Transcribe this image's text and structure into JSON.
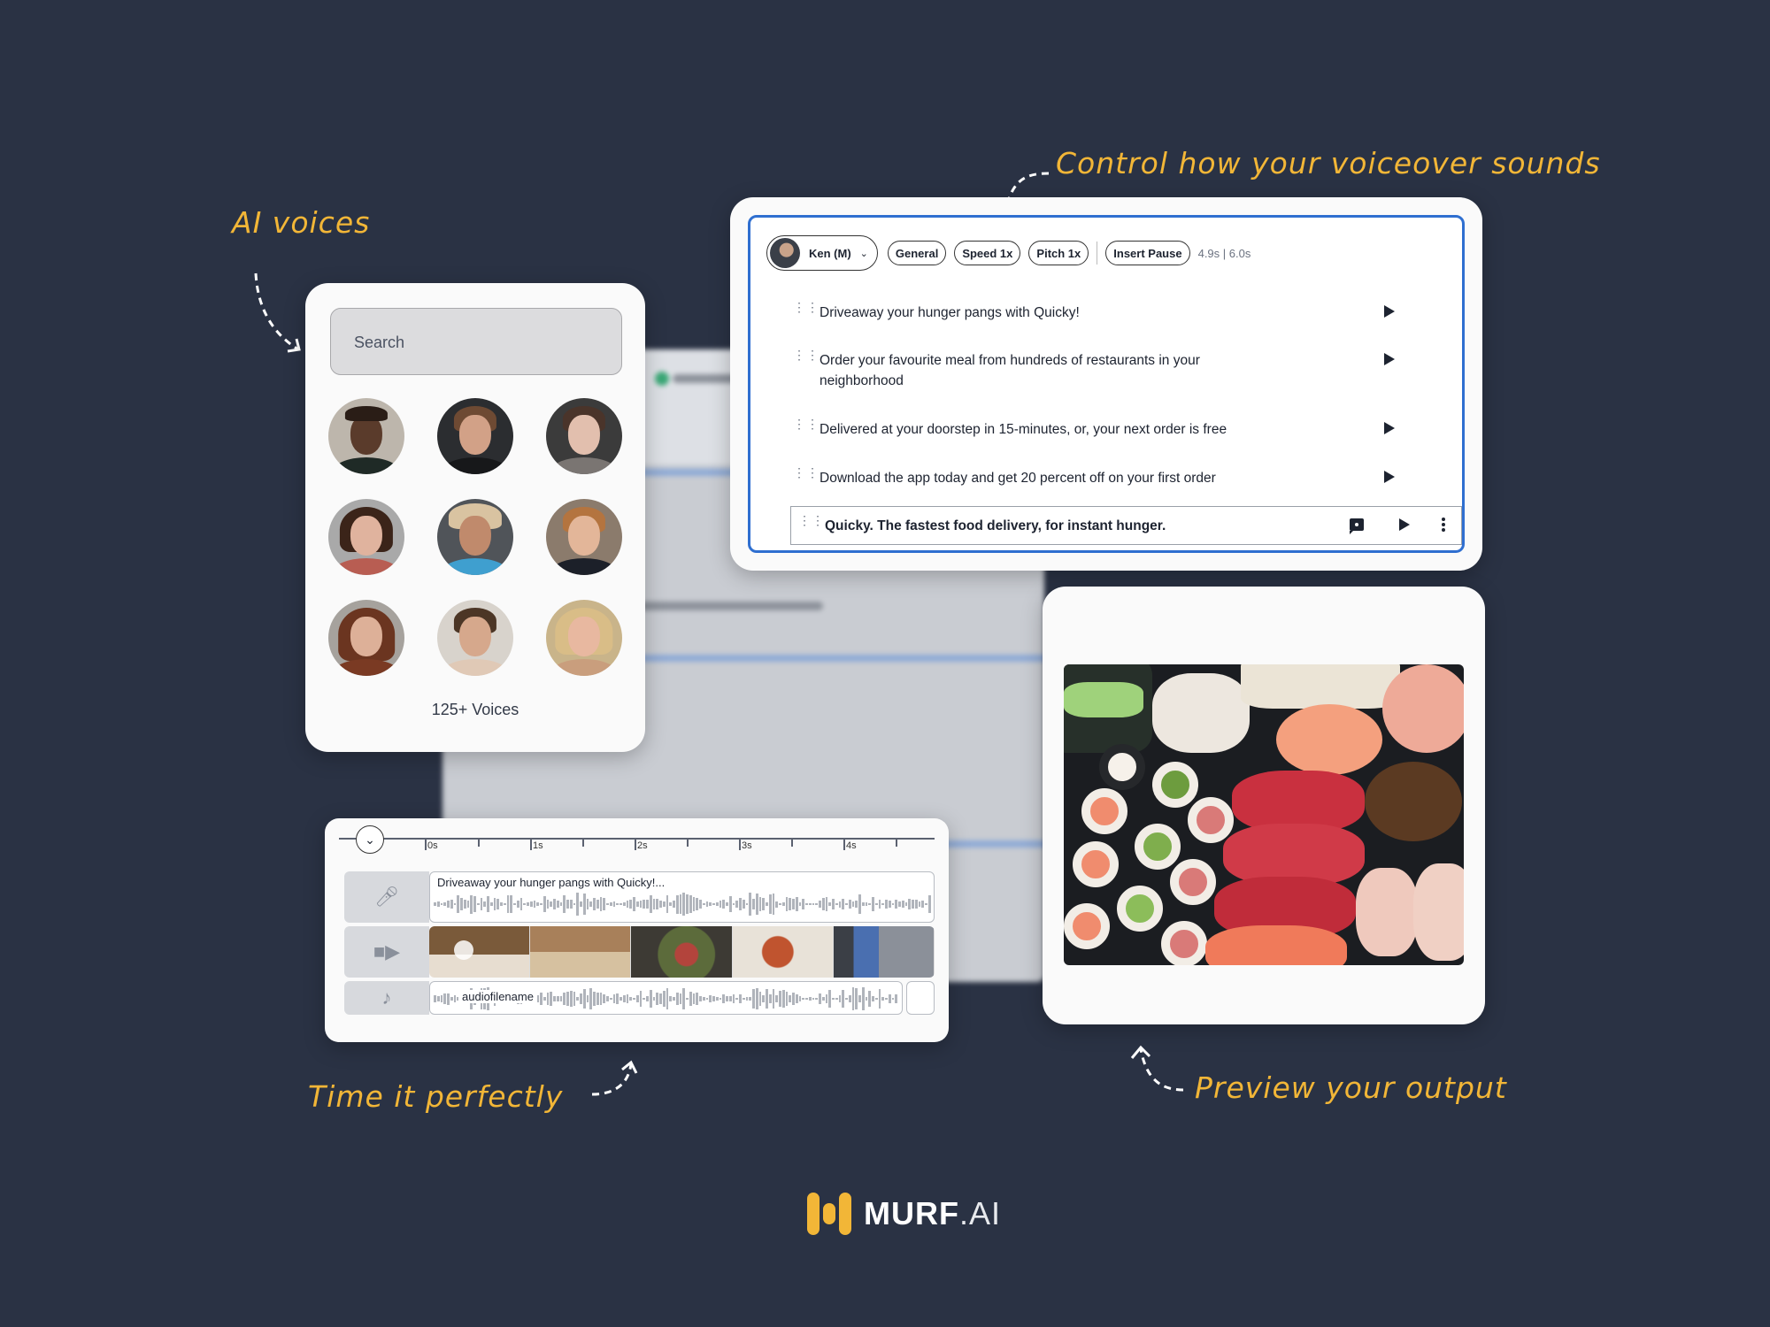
{
  "annotations": {
    "ai_voices": "AI voices",
    "control": "Control how your voiceover sounds",
    "time_it": "Time it perfectly",
    "preview": "Preview your output"
  },
  "voices_panel": {
    "search_placeholder": "Search",
    "count_label": "125+ Voices",
    "voices": [
      {
        "icon": "avatar-man-glasses-smiling"
      },
      {
        "icon": "avatar-man-glasses"
      },
      {
        "icon": "avatar-woman-earrings"
      },
      {
        "icon": "avatar-woman-brunette"
      },
      {
        "icon": "avatar-man-hat-sunglasses"
      },
      {
        "icon": "avatar-man-redhead"
      },
      {
        "icon": "avatar-woman-auburn"
      },
      {
        "icon": "avatar-man-young"
      },
      {
        "icon": "avatar-woman-blonde"
      }
    ]
  },
  "editor": {
    "voice_selector": "Ken (M)",
    "style": "General",
    "speed": "Speed 1x",
    "pitch": "Pitch 1x",
    "insert_pause": "Insert Pause",
    "duration": "4.9s | 6.0s",
    "lines": [
      {
        "text": "Driveaway your hunger pangs with Quicky!"
      },
      {
        "text": "Order your favourite meal from hundreds of restaurants in your neighborhood"
      },
      {
        "text": "Delivered at your doorstep in 15-minutes, or, your next order is free"
      },
      {
        "text": "Download the app today and get 20 percent off on your first order"
      },
      {
        "text": "Quicky. The fastest food delivery, for instant hunger.",
        "active": true
      }
    ],
    "accent_color": "#2f6fd0"
  },
  "timeline": {
    "ticks": [
      "0s",
      "1s",
      "2s",
      "3s",
      "4s"
    ],
    "voice_track_label": "Driveaway your hunger pangs with Quicky!...",
    "music_track_label": "audiofilename",
    "video_frames": [
      "pizza-slice",
      "pizza-box",
      "sandwich",
      "pizza-takeout",
      "phone-order"
    ]
  },
  "preview": {
    "image": "sushi-platter"
  },
  "brand": {
    "name": "MURF",
    "suffix": ".AI",
    "accent": "#f2b637",
    "background": "#2a3244"
  }
}
